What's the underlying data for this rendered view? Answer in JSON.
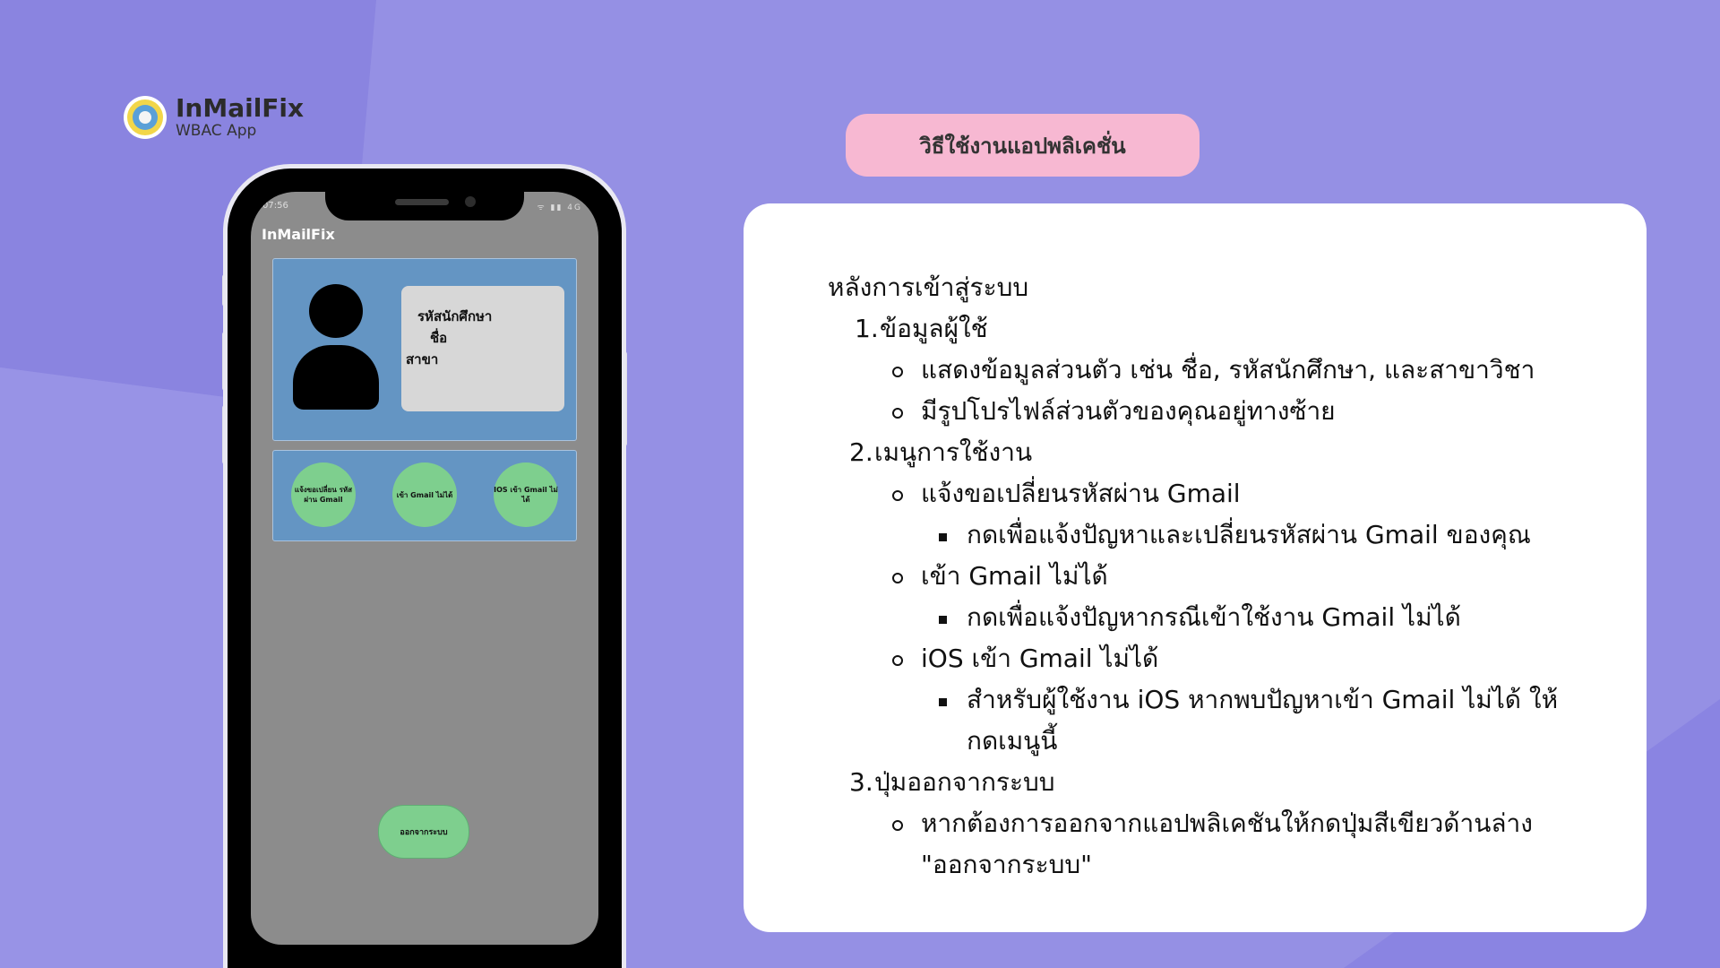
{
  "brand": {
    "title": "InMailFix",
    "subtitle": "WBAC App"
  },
  "phone": {
    "status_time": "07:56",
    "status_icons": "ᯤ ▮▮ 4G",
    "app_title": "InMailFix",
    "profile": {
      "student_id_label": "รหัสนักศึกษา",
      "name_label": "ชื่อ",
      "major_label": "สาขา"
    },
    "menu": [
      {
        "label": "แจ้งขอเปลี่ยน รหัสผ่าน Gmail"
      },
      {
        "label": "เข้า Gmail ไม่ได้"
      },
      {
        "label": "IOS เข้า Gmail ไม่ได้"
      }
    ],
    "logout_label": "ออกจากระบบ"
  },
  "heading": "วิธีใช้งานแอปพลิเคชั่น",
  "instructions": {
    "intro": "หลังการเข้าสู่ระบบ",
    "s1_num": "1.",
    "s1_title": "ข้อมูลผู้ใช้",
    "s1_b1": "แสดงข้อมูลส่วนตัว เช่น ชื่อ, รหัสนักศึกษา, และสาขาวิชา",
    "s1_b2": "มีรูปโปรไฟล์ส่วนตัวของคุณอยู่ทางซ้าย",
    "s2_num": "2.",
    "s2_title": "เมนูการใช้งาน",
    "s2_b1": "แจ้งขอเปลี่ยนรหัสผ่าน Gmail",
    "s2_b1_sub": "กดเพื่อแจ้งปัญหาและเปลี่ยนรหัสผ่าน Gmail ของคุณ",
    "s2_b2": "เข้า Gmail ไม่ได้",
    "s2_b2_sub": "กดเพื่อแจ้งปัญหากรณีเข้าใช้งาน Gmail ไม่ได้",
    "s2_b3": "iOS เข้า Gmail ไม่ได้",
    "s2_b3_sub1": "สำหรับผู้ใช้งาน iOS หากพบปัญหาเข้า Gmail ไม่ได้ ให้",
    "s2_b3_sub2": "กดเมนูนี้",
    "s3_num": "3.",
    "s3_title": "ปุ่มออกจากระบบ",
    "s3_b1_1": "หากต้องการออกจากแอปพลิเคชันให้กดปุ่มสีเขียวด้านล่าง",
    "s3_b1_2": "\"ออกจากระบบ\""
  },
  "colors": {
    "background": "#9590e4",
    "pill": "#f7b8d2",
    "card_blue": "#6495c3",
    "button_green": "#7ecf8e",
    "screen_gray": "#8c8c8c"
  },
  "icons": [
    "university-logo-icon",
    "user-avatar-icon"
  ]
}
